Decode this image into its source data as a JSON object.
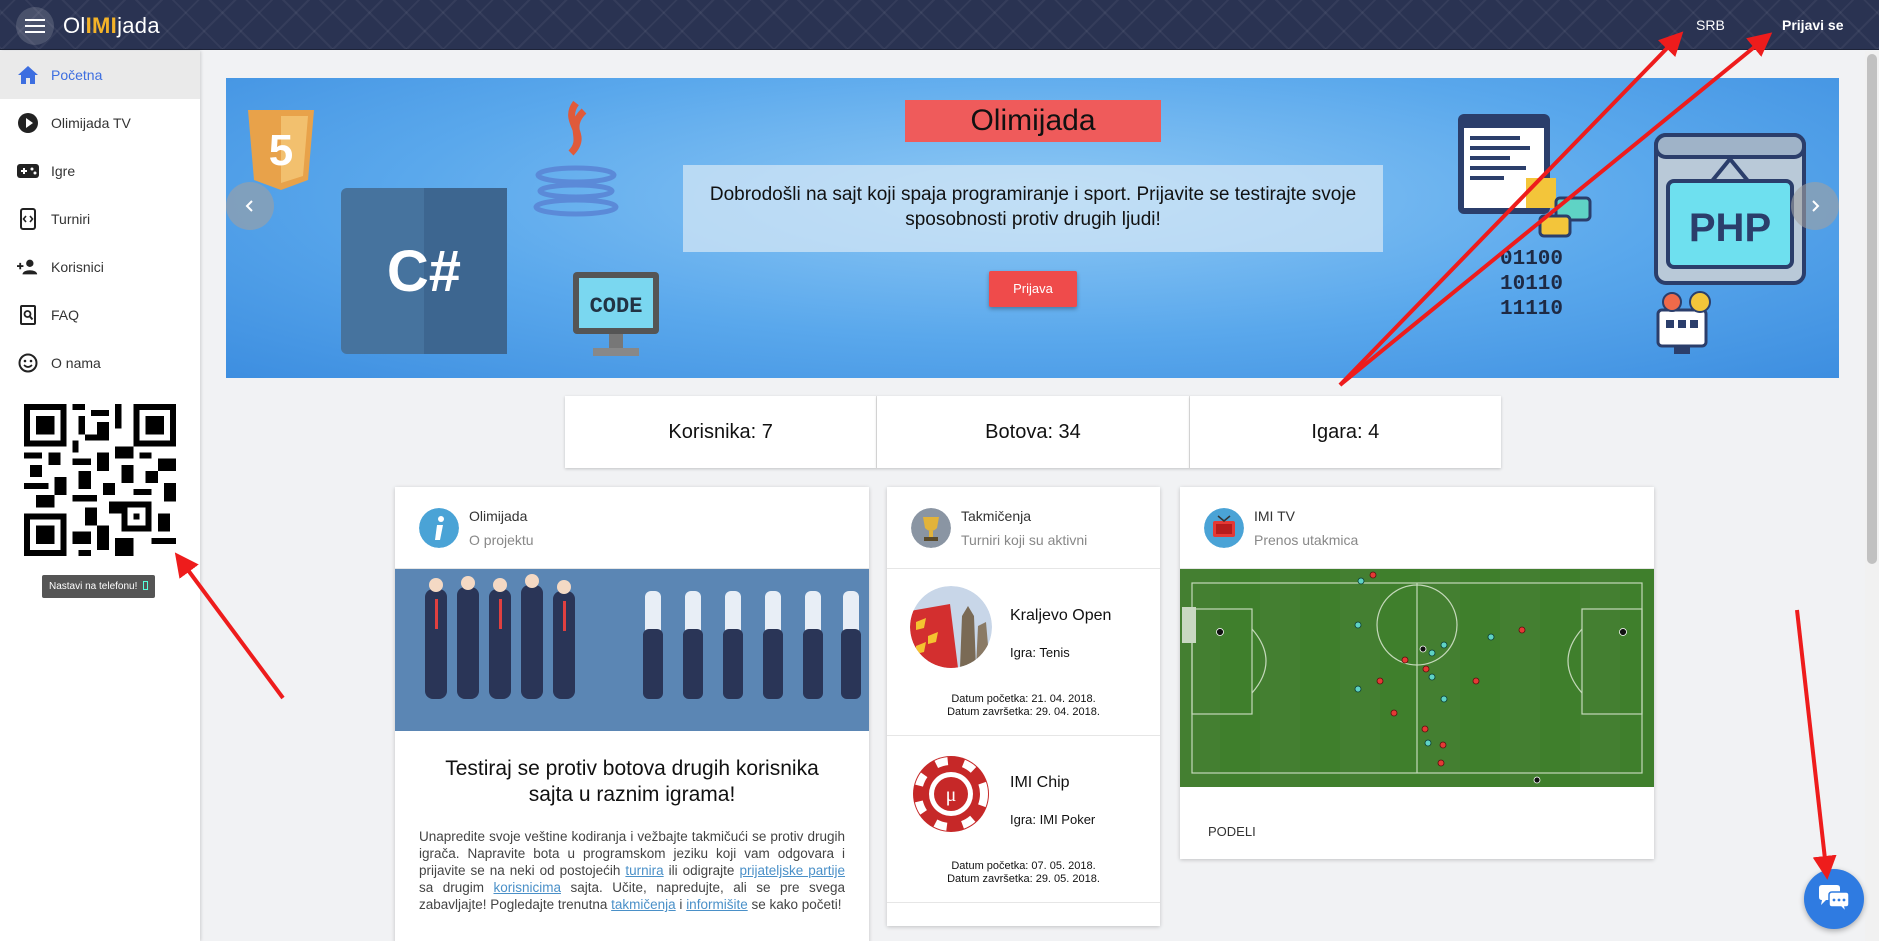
{
  "header": {
    "logo_pre": "Ol",
    "logo_imi": "IMI",
    "logo_post": "jada",
    "lang": "SRB",
    "login": "Prijavi se"
  },
  "sidebar": {
    "items": [
      {
        "label": "Početna",
        "icon": "home-icon"
      },
      {
        "label": "Olimijada TV",
        "icon": "play-icon"
      },
      {
        "label": "Igre",
        "icon": "gamepad-icon"
      },
      {
        "label": "Turniri",
        "icon": "code-icon"
      },
      {
        "label": "Korisnici",
        "icon": "users-icon"
      },
      {
        "label": "FAQ",
        "icon": "search-doc-icon"
      },
      {
        "label": "O nama",
        "icon": "smile-icon"
      }
    ],
    "qr_tooltip": "Nastavi na telefonu!"
  },
  "slider": {
    "title": "Olimijada",
    "text": "Dobrodošli na sajt koji spaja programiranje i sport. Prijavite se testirajte svoje sposobnosti protiv drugih ljudi!",
    "button": "Prijava",
    "decor": {
      "csharp": "C#",
      "code": "CODE",
      "php": "PHP",
      "binary": [
        "01100",
        "10110",
        "11110"
      ],
      "html": "5"
    }
  },
  "stats": {
    "users": "Korisnika: 7",
    "bots": "Botova: 34",
    "games": "Igara: 4"
  },
  "about_card": {
    "title": "Olimijada",
    "subtitle": "O projektu",
    "heading": "Testiraj se protiv botova drugih korisnika sajta u raznim igrama!",
    "p1": "Unapredite svoje veštine kodiranja i vežbajte takmičući se protiv drugih igrača. Napravite bota u programskom jeziku koji vam odgovara i prijavite se na neki od postojećih ",
    "link_turnira": "turnira",
    "p2": " ili odigrajte ",
    "link_partije": "prijateljske partije",
    "p3": " sa drugim ",
    "link_korisnicima": "korisnicima",
    "p4": " sajta. Učite, napredujte, ali se pre svega zabavljajte! Pogledajte trenutna ",
    "link_takmicenja": "takmičenja",
    "p5": " i ",
    "link_informisite": "informišite",
    "p6": " se kako početi!"
  },
  "competitions_card": {
    "title": "Takmičenja",
    "subtitle": "Turniri koji su aktivni",
    "tournaments": [
      {
        "name": "Kraljevo Open",
        "game": "Igra: Tenis",
        "start": "Datum početka: 21. 04. 2018.",
        "end": "Datum završetka: 29. 04. 2018."
      },
      {
        "name": "IMI Chip",
        "game": "Igra: IMI Poker",
        "start": "Datum početka: 07. 05. 2018.",
        "end": "Datum završetka: 29. 05. 2018."
      }
    ]
  },
  "tv_card": {
    "title": "IMI TV",
    "subtitle": "Prenos utakmica",
    "share": "PODELI"
  },
  "colors": {
    "accent": "#3d6ee0",
    "header_bg": "#2a3352",
    "logo_accent": "#f4b328",
    "slide_red": "#ef5b5b",
    "chat": "#2f7be1",
    "annotation_arrow": "#ee1c1c"
  }
}
